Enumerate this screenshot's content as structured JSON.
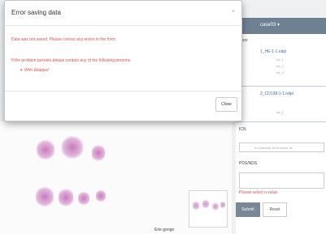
{
  "modal": {
    "title": "Error saving data",
    "close_glyph": "×",
    "message": "Data was not saved. Please correct any errors in the form.",
    "contact_message": "If the problem persists please contact any of the following persons:",
    "contact_bullet": "▾",
    "contact_person": "Wim Waelput",
    "close_button": "Close"
  },
  "app": {
    "case_select": "case03 ▾",
    "section_label": "Type",
    "items": [
      {
        "label": "1_HE-1-1.ndpi",
        "subs": [
          "#a_1",
          "#a_2",
          "#a_3"
        ]
      },
      {
        "label": "2_CD138-1-1.ndpi",
        "subs": [
          "#a_1"
        ]
      }
    ],
    "field1_label": "ICN",
    "field1_placeholder": "no (started) for immune ra",
    "field2_label": "PDS/NDS",
    "validation_error": "Please select a value",
    "submit_label": "Submit",
    "reset_label": "Reset",
    "footer_label": "Erie gonge"
  },
  "colors": {
    "error_red": "#d9534f",
    "header_slate": "#6e8193",
    "link_blue": "#3a72b8"
  }
}
